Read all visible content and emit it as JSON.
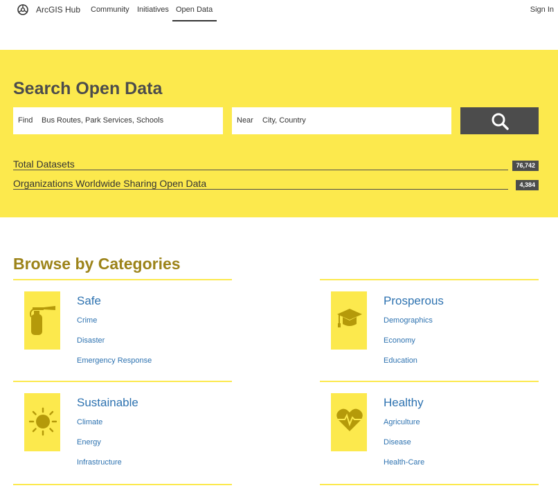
{
  "nav": {
    "brand": "ArcGIS Hub",
    "links": [
      "Community",
      "Initiatives",
      "Open Data"
    ],
    "active": "Open Data",
    "sign_in": "Sign In"
  },
  "hero": {
    "title": "Search Open Data",
    "find_label": "Find",
    "find_placeholder": "Bus Routes, Park Services, Schools",
    "near_label": "Near",
    "near_placeholder": "City, Country",
    "search_icon": "search-icon",
    "stats": [
      {
        "label": "Total Datasets",
        "value": "76,742"
      },
      {
        "label": "Organizations Worldwide Sharing Open Data",
        "value": "4,384"
      }
    ]
  },
  "categories": {
    "title": "Browse by Categories",
    "items": [
      {
        "name": "Safe",
        "icon": "fire-extinguisher-icon",
        "links": [
          "Crime",
          "Disaster",
          "Emergency Response"
        ]
      },
      {
        "name": "Prosperous",
        "icon": "graduation-cap-icon",
        "links": [
          "Demographics",
          "Economy",
          "Education"
        ]
      },
      {
        "name": "Sustainable",
        "icon": "sun-icon",
        "links": [
          "Climate",
          "Energy",
          "Infrastructure"
        ]
      },
      {
        "name": "Healthy",
        "icon": "heartbeat-icon",
        "links": [
          "Agriculture",
          "Disease",
          "Health-Care"
        ]
      }
    ]
  },
  "colors": {
    "accent_yellow": "#fce94d",
    "dark": "#4c4c4c",
    "heading_gold": "#9c8319",
    "link_blue": "#2d72b0",
    "icon_gold": "#b59a0a"
  }
}
